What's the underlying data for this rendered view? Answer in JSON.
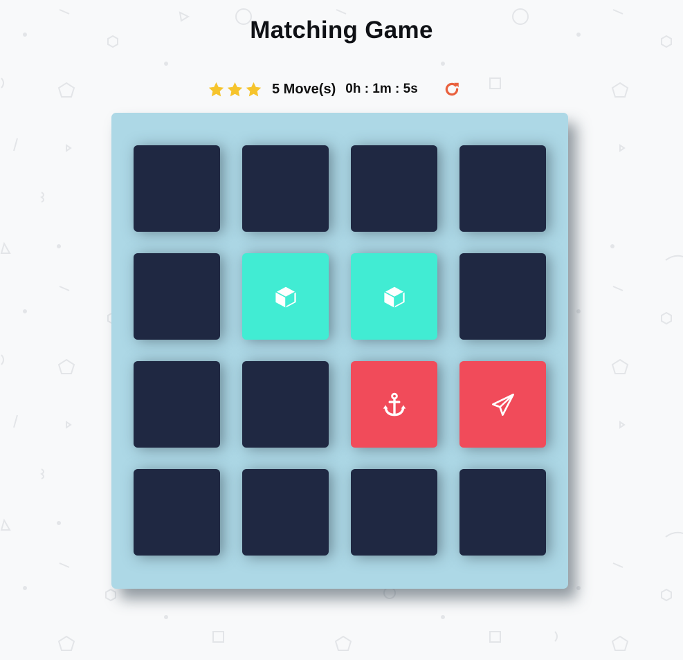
{
  "title": "Matching Game",
  "score_panel": {
    "stars": [
      "star-icon",
      "star-icon",
      "star-icon"
    ],
    "moves_text": "5 Move(s)",
    "timer_text": "0h : 1m : 5s",
    "restart_icon": "restart-icon"
  },
  "colors": {
    "background": "#f8f9fa",
    "deck": "#add8e6",
    "card_back": "#1f2842",
    "card_match": "#41ecd3",
    "card_open_nomatch": "#f14b5a",
    "star": "#f6c42c",
    "restart": "#e9613e"
  },
  "deck": {
    "rows": [
      [
        {
          "state": "hidden",
          "icon": ""
        },
        {
          "state": "hidden",
          "icon": ""
        },
        {
          "state": "hidden",
          "icon": ""
        },
        {
          "state": "hidden",
          "icon": ""
        }
      ],
      [
        {
          "state": "hidden",
          "icon": ""
        },
        {
          "state": "match",
          "icon": "cube-icon"
        },
        {
          "state": "match",
          "icon": "cube-icon"
        },
        {
          "state": "hidden",
          "icon": ""
        }
      ],
      [
        {
          "state": "hidden",
          "icon": ""
        },
        {
          "state": "hidden",
          "icon": ""
        },
        {
          "state": "open-nomatch",
          "icon": "anchor-icon"
        },
        {
          "state": "open-nomatch",
          "icon": "paper-plane-icon"
        }
      ],
      [
        {
          "state": "hidden",
          "icon": ""
        },
        {
          "state": "hidden",
          "icon": ""
        },
        {
          "state": "hidden",
          "icon": ""
        },
        {
          "state": "hidden",
          "icon": ""
        }
      ]
    ]
  }
}
